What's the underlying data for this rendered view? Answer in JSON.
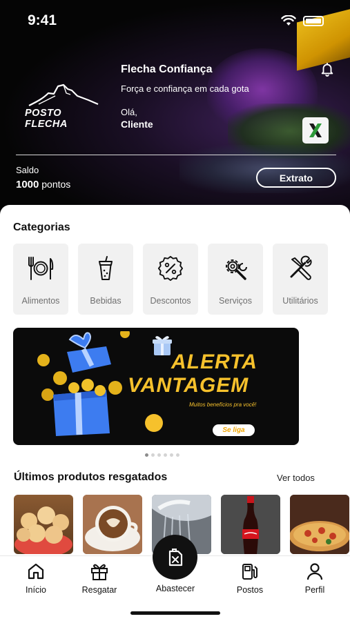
{
  "status_bar": {
    "time": "9:41"
  },
  "header": {
    "logo_text": "POSTO FLECHA",
    "title": "Flecha Confiança",
    "subtitle": "Força e confiança em cada gota",
    "greeting": "Olá,",
    "user_name": "Cliente",
    "balance_label": "Saldo",
    "balance_amount": "1000",
    "balance_unit": "pontos",
    "statement_button": "Extrato"
  },
  "categories": {
    "title": "Categorias",
    "items": [
      {
        "label": "Alimentos",
        "icon": "fork-knife-plate-icon"
      },
      {
        "label": "Bebidas",
        "icon": "cup-with-straw-icon"
      },
      {
        "label": "Descontos",
        "icon": "percent-badge-icon"
      },
      {
        "label": "Serviços",
        "icon": "gear-wrench-icon"
      },
      {
        "label": "Utilitários",
        "icon": "tools-icon"
      }
    ]
  },
  "banner": {
    "line1": "ALERTA",
    "line2": "VANTAGEM",
    "tagline": "Muitos benefícios pra você!",
    "cta": "Se liga",
    "slide_count": 6,
    "active_slide": 0
  },
  "products": {
    "title": "Últimos produtos resgatados",
    "see_all": "Ver todos",
    "items": [
      {
        "image": "cheese-bread-photo"
      },
      {
        "image": "cappuccino-photo"
      },
      {
        "image": "car-wash-photo"
      },
      {
        "image": "coca-cola-bottle-photo"
      },
      {
        "image": "pizza-photo"
      }
    ]
  },
  "tabbar": {
    "items": [
      {
        "label": "Início",
        "icon": "home-icon"
      },
      {
        "label": "Resgatar",
        "icon": "gift-icon"
      },
      {
        "label": "Abastecer",
        "icon": "fuel-can-icon"
      },
      {
        "label": "Postos",
        "icon": "gas-station-icon"
      },
      {
        "label": "Perfil",
        "icon": "user-icon"
      }
    ]
  },
  "colors": {
    "accent_yellow": "#f6c12c",
    "dark": "#111111",
    "card_bg": "#f1f1f1"
  }
}
